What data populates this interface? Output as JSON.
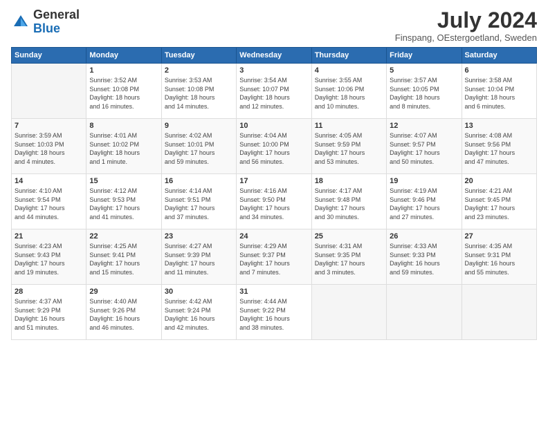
{
  "header": {
    "logo_general": "General",
    "logo_blue": "Blue",
    "month_title": "July 2024",
    "location": "Finspang, OEstergoetland, Sweden"
  },
  "weekdays": [
    "Sunday",
    "Monday",
    "Tuesday",
    "Wednesday",
    "Thursday",
    "Friday",
    "Saturday"
  ],
  "weeks": [
    [
      {
        "day": "",
        "info": ""
      },
      {
        "day": "1",
        "info": "Sunrise: 3:52 AM\nSunset: 10:08 PM\nDaylight: 18 hours\nand 16 minutes."
      },
      {
        "day": "2",
        "info": "Sunrise: 3:53 AM\nSunset: 10:08 PM\nDaylight: 18 hours\nand 14 minutes."
      },
      {
        "day": "3",
        "info": "Sunrise: 3:54 AM\nSunset: 10:07 PM\nDaylight: 18 hours\nand 12 minutes."
      },
      {
        "day": "4",
        "info": "Sunrise: 3:55 AM\nSunset: 10:06 PM\nDaylight: 18 hours\nand 10 minutes."
      },
      {
        "day": "5",
        "info": "Sunrise: 3:57 AM\nSunset: 10:05 PM\nDaylight: 18 hours\nand 8 minutes."
      },
      {
        "day": "6",
        "info": "Sunrise: 3:58 AM\nSunset: 10:04 PM\nDaylight: 18 hours\nand 6 minutes."
      }
    ],
    [
      {
        "day": "7",
        "info": "Sunrise: 3:59 AM\nSunset: 10:03 PM\nDaylight: 18 hours\nand 4 minutes."
      },
      {
        "day": "8",
        "info": "Sunrise: 4:01 AM\nSunset: 10:02 PM\nDaylight: 18 hours\nand 1 minute."
      },
      {
        "day": "9",
        "info": "Sunrise: 4:02 AM\nSunset: 10:01 PM\nDaylight: 17 hours\nand 59 minutes."
      },
      {
        "day": "10",
        "info": "Sunrise: 4:04 AM\nSunset: 10:00 PM\nDaylight: 17 hours\nand 56 minutes."
      },
      {
        "day": "11",
        "info": "Sunrise: 4:05 AM\nSunset: 9:59 PM\nDaylight: 17 hours\nand 53 minutes."
      },
      {
        "day": "12",
        "info": "Sunrise: 4:07 AM\nSunset: 9:57 PM\nDaylight: 17 hours\nand 50 minutes."
      },
      {
        "day": "13",
        "info": "Sunrise: 4:08 AM\nSunset: 9:56 PM\nDaylight: 17 hours\nand 47 minutes."
      }
    ],
    [
      {
        "day": "14",
        "info": "Sunrise: 4:10 AM\nSunset: 9:54 PM\nDaylight: 17 hours\nand 44 minutes."
      },
      {
        "day": "15",
        "info": "Sunrise: 4:12 AM\nSunset: 9:53 PM\nDaylight: 17 hours\nand 41 minutes."
      },
      {
        "day": "16",
        "info": "Sunrise: 4:14 AM\nSunset: 9:51 PM\nDaylight: 17 hours\nand 37 minutes."
      },
      {
        "day": "17",
        "info": "Sunrise: 4:16 AM\nSunset: 9:50 PM\nDaylight: 17 hours\nand 34 minutes."
      },
      {
        "day": "18",
        "info": "Sunrise: 4:17 AM\nSunset: 9:48 PM\nDaylight: 17 hours\nand 30 minutes."
      },
      {
        "day": "19",
        "info": "Sunrise: 4:19 AM\nSunset: 9:46 PM\nDaylight: 17 hours\nand 27 minutes."
      },
      {
        "day": "20",
        "info": "Sunrise: 4:21 AM\nSunset: 9:45 PM\nDaylight: 17 hours\nand 23 minutes."
      }
    ],
    [
      {
        "day": "21",
        "info": "Sunrise: 4:23 AM\nSunset: 9:43 PM\nDaylight: 17 hours\nand 19 minutes."
      },
      {
        "day": "22",
        "info": "Sunrise: 4:25 AM\nSunset: 9:41 PM\nDaylight: 17 hours\nand 15 minutes."
      },
      {
        "day": "23",
        "info": "Sunrise: 4:27 AM\nSunset: 9:39 PM\nDaylight: 17 hours\nand 11 minutes."
      },
      {
        "day": "24",
        "info": "Sunrise: 4:29 AM\nSunset: 9:37 PM\nDaylight: 17 hours\nand 7 minutes."
      },
      {
        "day": "25",
        "info": "Sunrise: 4:31 AM\nSunset: 9:35 PM\nDaylight: 17 hours\nand 3 minutes."
      },
      {
        "day": "26",
        "info": "Sunrise: 4:33 AM\nSunset: 9:33 PM\nDaylight: 16 hours\nand 59 minutes."
      },
      {
        "day": "27",
        "info": "Sunrise: 4:35 AM\nSunset: 9:31 PM\nDaylight: 16 hours\nand 55 minutes."
      }
    ],
    [
      {
        "day": "28",
        "info": "Sunrise: 4:37 AM\nSunset: 9:29 PM\nDaylight: 16 hours\nand 51 minutes."
      },
      {
        "day": "29",
        "info": "Sunrise: 4:40 AM\nSunset: 9:26 PM\nDaylight: 16 hours\nand 46 minutes."
      },
      {
        "day": "30",
        "info": "Sunrise: 4:42 AM\nSunset: 9:24 PM\nDaylight: 16 hours\nand 42 minutes."
      },
      {
        "day": "31",
        "info": "Sunrise: 4:44 AM\nSunset: 9:22 PM\nDaylight: 16 hours\nand 38 minutes."
      },
      {
        "day": "",
        "info": ""
      },
      {
        "day": "",
        "info": ""
      },
      {
        "day": "",
        "info": ""
      }
    ]
  ]
}
